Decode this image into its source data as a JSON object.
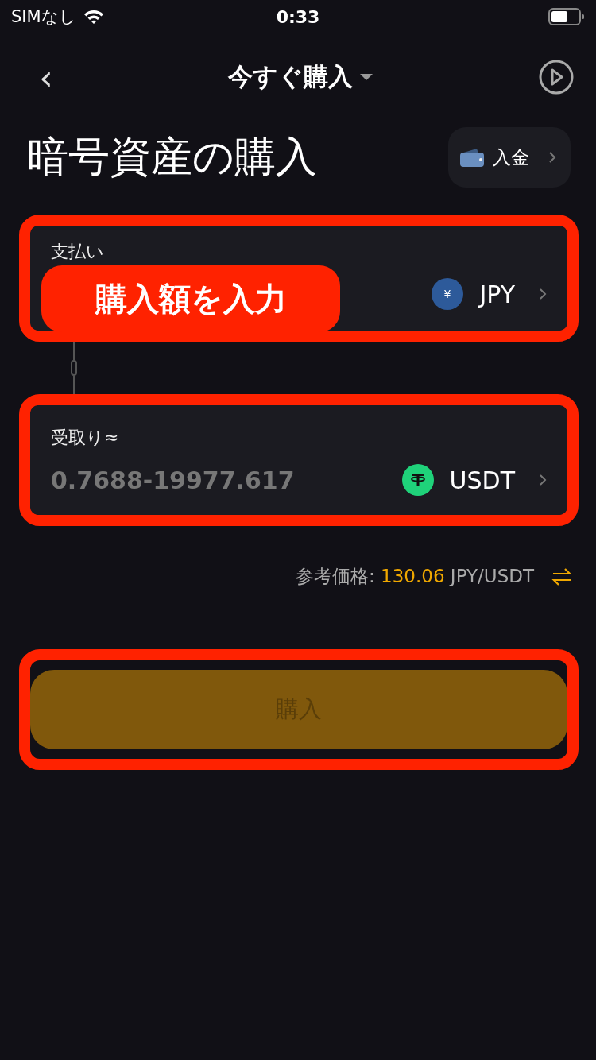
{
  "status_bar": {
    "carrier": "SIMなし",
    "time": "0:33"
  },
  "nav": {
    "back": "‹",
    "title": "今すぐ購入"
  },
  "header": {
    "title": "暗号資産の購入",
    "deposit_label": "入金"
  },
  "pay": {
    "label": "支払い",
    "currency": "JPY",
    "coin_symbol": "¥"
  },
  "callout": "購入額を入力",
  "receive": {
    "label": "受取り≈",
    "placeholder": "0.7688-19977.617",
    "currency": "USDT"
  },
  "rate": {
    "label": "参考価格:",
    "value": "130.06",
    "unit": "JPY/USDT"
  },
  "buy_button": {
    "label": "購入",
    "disabled": true
  }
}
